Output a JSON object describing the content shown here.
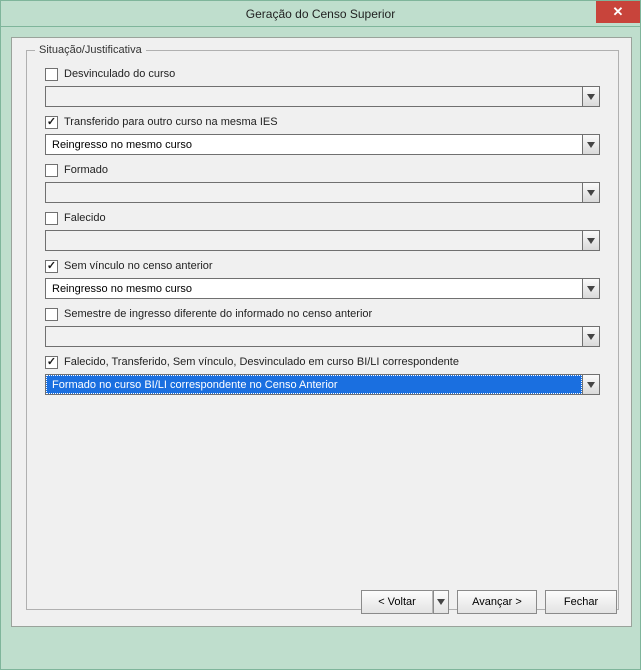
{
  "window": {
    "title": "Geração do Censo Superior",
    "close_label": "✕"
  },
  "groupbox": {
    "title": "Situação/Justificativa"
  },
  "items": [
    {
      "checked": false,
      "label": "Desvinculado do curso",
      "value": "",
      "disabled": true,
      "highlight": false
    },
    {
      "checked": true,
      "label": "Transferido para outro curso na mesma IES",
      "value": "Reingresso no mesmo curso",
      "disabled": false,
      "highlight": false
    },
    {
      "checked": false,
      "label": "Formado",
      "value": "",
      "disabled": true,
      "highlight": false
    },
    {
      "checked": false,
      "label": "Falecido",
      "value": "",
      "disabled": true,
      "highlight": false
    },
    {
      "checked": true,
      "label": "Sem vínculo no censo anterior",
      "value": "Reingresso no mesmo curso",
      "disabled": false,
      "highlight": false
    },
    {
      "checked": false,
      "label": "Semestre de ingresso diferente do informado no censo anterior",
      "value": "",
      "disabled": true,
      "highlight": false
    },
    {
      "checked": true,
      "label": "Falecido, Transferido, Sem vínculo, Desvinculado em curso BI/LI correspondente",
      "value": "Formado no curso BI/LI correspondente no Censo Anterior",
      "disabled": false,
      "highlight": true
    }
  ],
  "buttons": {
    "back": "< Voltar",
    "next": "Avançar >",
    "close": "Fechar"
  }
}
